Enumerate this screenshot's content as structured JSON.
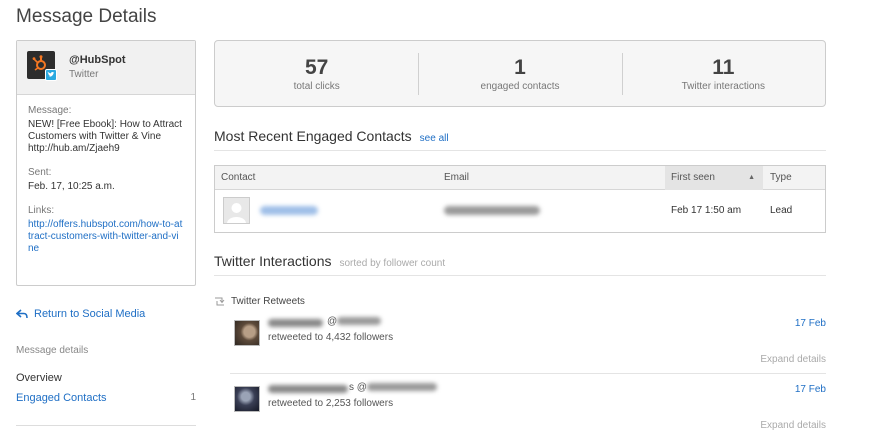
{
  "page": {
    "title": "Message Details"
  },
  "message_card": {
    "handle": "@HubSpot",
    "network": "Twitter",
    "message_label": "Message:",
    "message_text": "NEW! [Free Ebook]: How to Attract Customers with Twitter & Vine http://hub.am/Zjaeh9",
    "sent_label": "Sent:",
    "sent_value": "Feb. 17, 10:25 a.m.",
    "links_label": "Links:",
    "link_url": "http://offers.hubspot.com/how-to-attract-customers-with-twitter-and-vine"
  },
  "sidebar": {
    "return_label": "Return to Social Media",
    "section_label": "Message details",
    "overview_label": "Overview",
    "engaged_contacts_label": "Engaged Contacts",
    "engaged_contacts_count": "1"
  },
  "stats": [
    {
      "value": "57",
      "label": "total clicks"
    },
    {
      "value": "1",
      "label": "engaged contacts"
    },
    {
      "value": "11",
      "label": "Twitter interactions"
    }
  ],
  "contacts_section": {
    "title": "Most Recent Engaged Contacts",
    "see_all": "see all",
    "columns": {
      "contact": "Contact",
      "email": "Email",
      "first_seen": "First seen",
      "type": "Type"
    },
    "sort_indicator": "▲",
    "rows": [
      {
        "first_seen": "Feb 17 1:50 am",
        "type": "Lead"
      }
    ]
  },
  "twitter_section": {
    "title": "Twitter Interactions",
    "subtitle": "sorted by follower count",
    "retweets_label": "Twitter Retweets",
    "interactions": [
      {
        "handle_prefix": "@",
        "text": "retweeted to 4,432 followers",
        "date": "17 Feb",
        "expand": "Expand details"
      },
      {
        "handle_prefix": "@",
        "text": "retweeted to 2,253 followers",
        "date": "17 Feb",
        "expand": "Expand details",
        "name_suffix": "s"
      }
    ]
  },
  "colors": {
    "link": "#1f6fc5",
    "twitter": "#2aa9e0",
    "hubspot_bg": "#2d2d2d",
    "hubspot_orange": "#f57722"
  }
}
